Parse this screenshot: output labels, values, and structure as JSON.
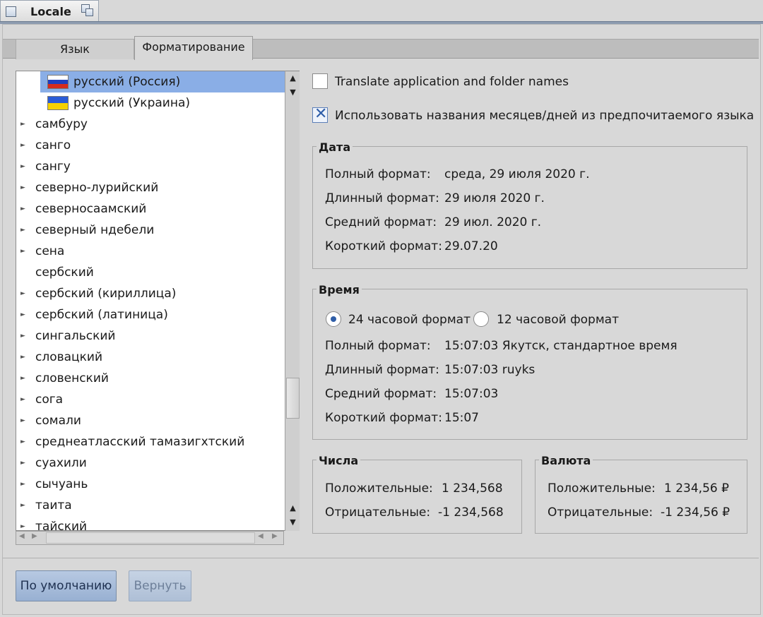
{
  "window": {
    "title": "Locale"
  },
  "tabs": [
    {
      "label": "Язык"
    },
    {
      "label": "Форматирование"
    }
  ],
  "language_list": {
    "items": [
      {
        "label": "русский (Россия)",
        "flag": "russia-flag",
        "selected": true,
        "expandable": false
      },
      {
        "label": "русский (Украина)",
        "flag": "ukraine-flag",
        "selected": false,
        "expandable": false
      },
      {
        "label": "самбуру",
        "expandable": true
      },
      {
        "label": "санго",
        "expandable": true
      },
      {
        "label": "сангу",
        "expandable": true
      },
      {
        "label": "северно-лурийский",
        "expandable": true
      },
      {
        "label": "северносаамский",
        "expandable": true
      },
      {
        "label": "северный ндебели",
        "expandable": true
      },
      {
        "label": "сена",
        "expandable": true
      },
      {
        "label": "сербский",
        "expandable": false
      },
      {
        "label": "сербский (кириллица)",
        "expandable": true
      },
      {
        "label": "сербский (латиница)",
        "expandable": true
      },
      {
        "label": "сингальский",
        "expandable": true
      },
      {
        "label": "словацкий",
        "expandable": true
      },
      {
        "label": "словенский",
        "expandable": true
      },
      {
        "label": "сога",
        "expandable": true
      },
      {
        "label": "сомали",
        "expandable": true
      },
      {
        "label": "среднеатласский тамазигхтский",
        "expandable": true
      },
      {
        "label": "суахили",
        "expandable": true
      },
      {
        "label": "сычуань",
        "expandable": true
      },
      {
        "label": "таита",
        "expandable": true
      },
      {
        "label": "тайский",
        "expandable": true
      }
    ]
  },
  "options": {
    "translate_names": {
      "label": "Translate application and folder names",
      "checked": false
    },
    "use_month_names": {
      "label": "Использовать названия месяцев/дней из предпочитаемого языка",
      "checked": true
    }
  },
  "date_group": {
    "title": "Дата",
    "rows": [
      {
        "label": "Полный формат:",
        "value": "среда, 29 июля 2020 г."
      },
      {
        "label": "Длинный формат:",
        "value": "29 июля 2020 г."
      },
      {
        "label": "Средний формат:",
        "value": "29 июл. 2020 г."
      },
      {
        "label": "Короткий формат:",
        "value": "29.07.20"
      }
    ]
  },
  "time_group": {
    "title": "Время",
    "radio_24": "24 часовой формат",
    "radio_12": "12 часовой формат",
    "selected": "24",
    "rows": [
      {
        "label": "Полный формат:",
        "value": "15:07:03 Якутск, стандартное время"
      },
      {
        "label": "Длинный формат:",
        "value": "15:07:03 ruyks"
      },
      {
        "label": "Средний формат:",
        "value": "15:07:03"
      },
      {
        "label": "Короткий формат:",
        "value": "15:07"
      }
    ]
  },
  "numbers_group": {
    "title": "Числа",
    "positive_label": "Положительные:",
    "positive_value": "1 234,568",
    "negative_label": "Отрицательные:",
    "negative_value": "-1 234,568"
  },
  "currency_group": {
    "title": "Валюта",
    "positive_label": "Положительные:",
    "positive_value": "1 234,56 ₽",
    "negative_label": "Отрицательные:",
    "negative_value": "-1 234,56 ₽"
  },
  "buttons": {
    "default_label": "По умолчанию",
    "revert_label": "Вернуть"
  },
  "colors": {
    "selection": "#8aaee6",
    "accent": "#2f5ea8"
  }
}
